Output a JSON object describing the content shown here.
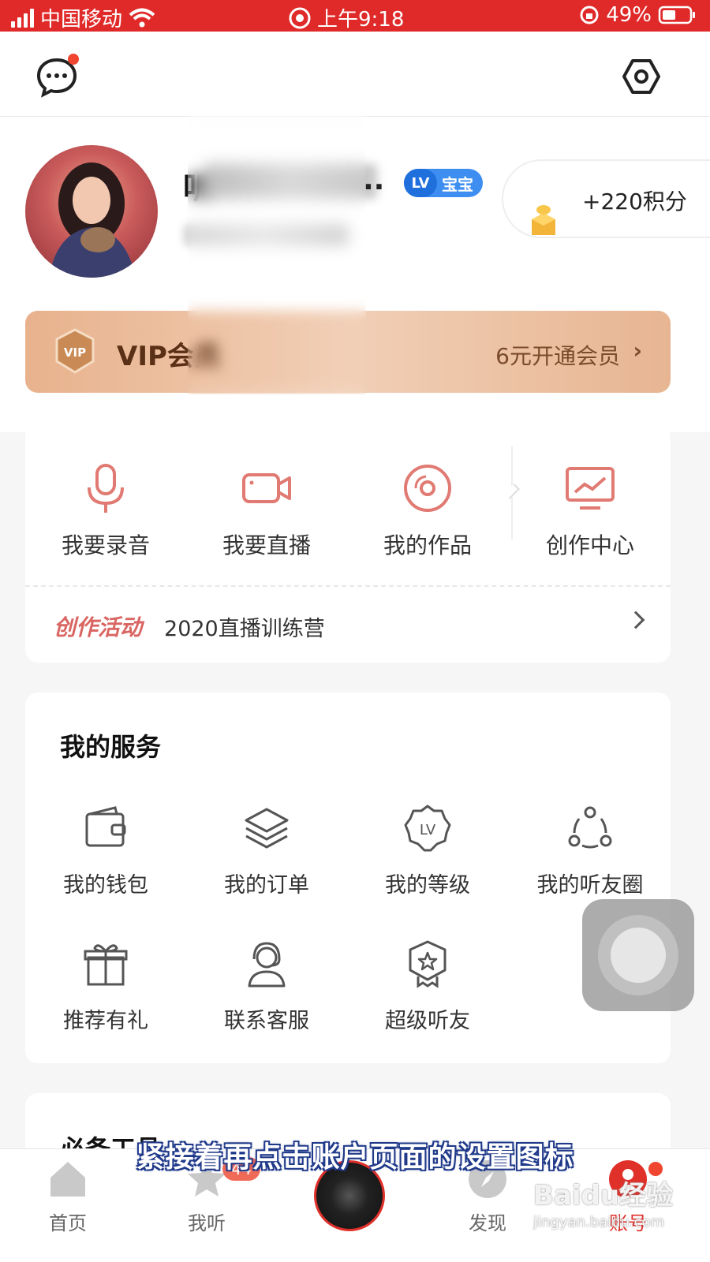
{
  "status_bar": {
    "carrier": "中国移动",
    "time": "上午9:18",
    "battery": "49%"
  },
  "top_bar": {
    "message_icon": "chat-bubble-icon",
    "settings_icon": "hexagon-settings-icon"
  },
  "profile": {
    "name_visible_prefix": "听",
    "name_ellipsis": "..",
    "level_badge": {
      "level": "LV",
      "title": "宝宝"
    },
    "points": "+220积分"
  },
  "vip_banner": {
    "badge": "VIP",
    "title": "VIP会员",
    "cta": "6元开通会员",
    "chevron": "›"
  },
  "create_section": {
    "items": [
      {
        "label": "我要录音",
        "icon": "microphone-icon"
      },
      {
        "label": "我要直播",
        "icon": "video-camera-icon"
      },
      {
        "label": "我的作品",
        "icon": "disc-icon"
      },
      {
        "label": "创作中心",
        "icon": "monitor-chart-icon"
      }
    ],
    "activity_tag": "创作活动",
    "activity_text": "2020直播训练营"
  },
  "services": {
    "title": "我的服务",
    "items": [
      {
        "label": "我的钱包",
        "icon": "wallet-icon"
      },
      {
        "label": "我的订单",
        "icon": "layers-icon"
      },
      {
        "label": "我的等级",
        "icon": "level-badge-icon"
      },
      {
        "label": "我的听友圈",
        "icon": "friends-circle-icon"
      },
      {
        "label": "推荐有礼",
        "icon": "gift-icon"
      },
      {
        "label": "联系客服",
        "icon": "headset-icon"
      },
      {
        "label": "超级听友",
        "icon": "star-badge-icon"
      }
    ]
  },
  "tools": {
    "title": "必备工具"
  },
  "tab_bar": {
    "tabs": [
      {
        "label": "首页",
        "icon": "home-icon"
      },
      {
        "label": "我听",
        "icon": "star-icon",
        "badge": "44"
      },
      {
        "label": "",
        "icon": "now-playing-disc-icon"
      },
      {
        "label": "发现",
        "icon": "compass-icon"
      },
      {
        "label": "账号",
        "icon": "account-icon"
      }
    ],
    "active_tab": "账号"
  },
  "overlay": {
    "subtitle": "紧接着再点击账户页面的设置图标",
    "watermark_main": "Baidu经验",
    "watermark_sub": "jingyan.baidu.com"
  },
  "colors": {
    "brand_red": "#e0302a",
    "accent_icon": "#e07a72",
    "vip_gold": "#e8b28d"
  }
}
